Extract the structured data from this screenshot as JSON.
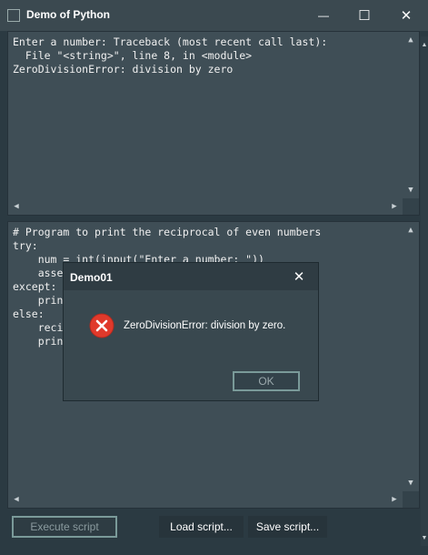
{
  "window": {
    "title": "Demo of Python",
    "minimize_symbol": "—",
    "maximize_symbol": "☐",
    "close_symbol": "✕"
  },
  "output_pane": {
    "text": "Enter a number: Traceback (most recent call last):\n  File \"<string>\", line 8, in <module>\nZeroDivisionError: division by zero"
  },
  "code_pane": {
    "text": "# Program to print the reciprocal of even numbers\ntry:\n    num = int(input(\"Enter a number: \"))\n    asse\nexcept:\n    prin\nelse:\n    reci\n    prin"
  },
  "buttons": {
    "execute": "Execute script",
    "load": "Load script...",
    "save": "Save script..."
  },
  "dialog": {
    "title": "Demo01",
    "close_symbol": "✕",
    "message": "ZeroDivisionError: division by zero.",
    "ok_label": "OK",
    "icon": "error-icon",
    "icon_color": "#e0392b"
  },
  "scroll": {
    "up": "▲",
    "down": "▼",
    "left": "◀",
    "right": "▶"
  },
  "colors": {
    "background": "#2b3a42",
    "pane": "#3f4e56",
    "titlebar": "#3b4950"
  }
}
